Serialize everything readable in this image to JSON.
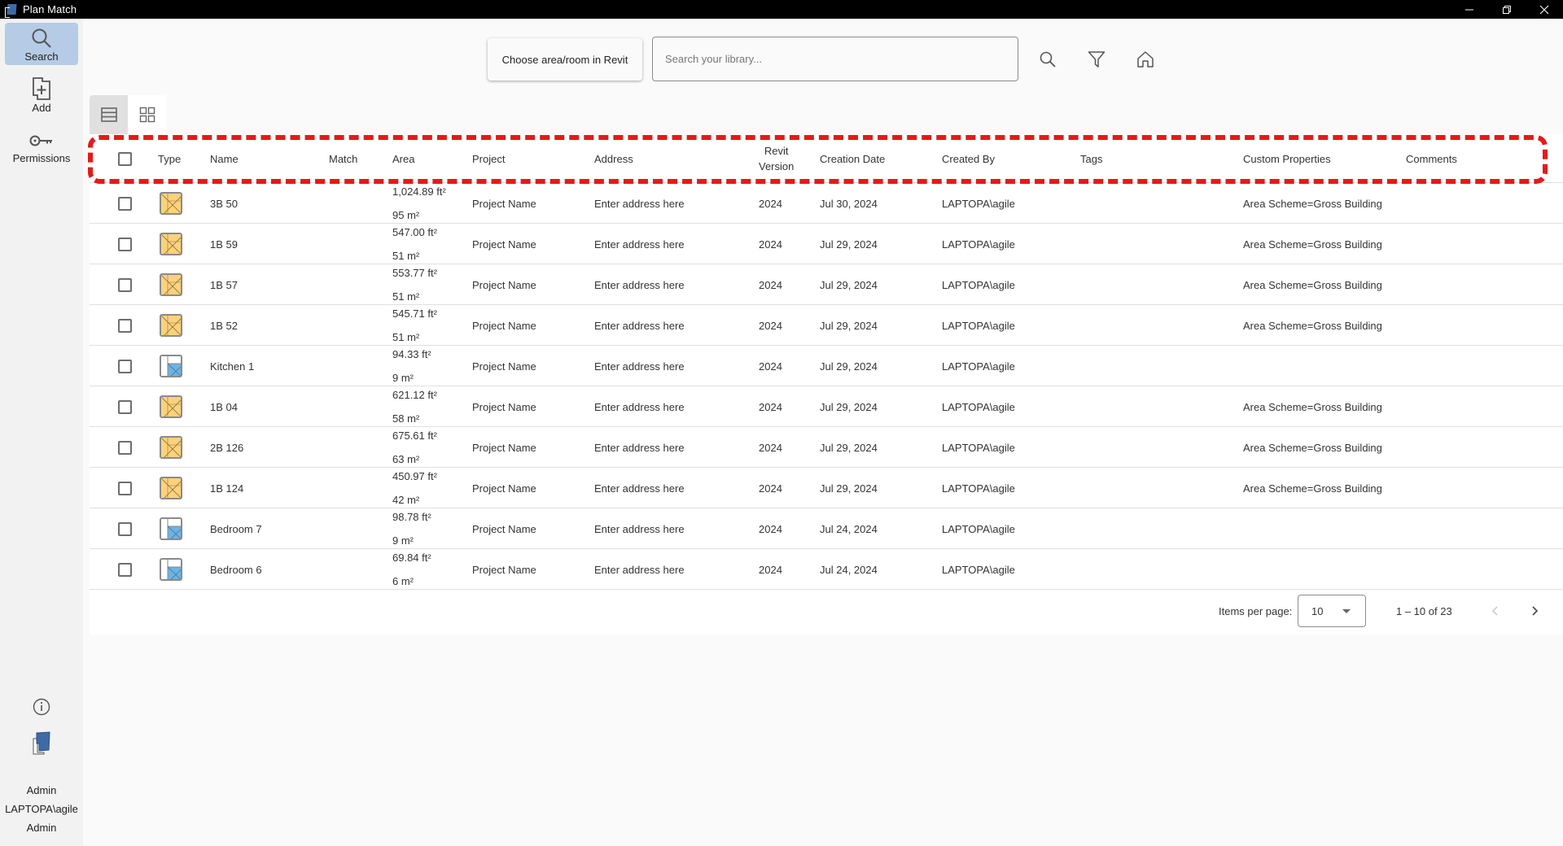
{
  "window": {
    "title": "Plan Match",
    "minimize_icon": "minimize-icon",
    "restore_icon": "restore-icon",
    "close_icon": "close-icon"
  },
  "sidebar": {
    "items": [
      {
        "label": "Search",
        "icon": "search-icon",
        "active": true
      },
      {
        "label": "Add",
        "icon": "add-document-icon",
        "active": false
      },
      {
        "label": "Permissions",
        "icon": "key-icon",
        "active": false
      }
    ],
    "info_icon": "info-icon",
    "logo_icon": "plan-match-logo-icon",
    "user": {
      "role": "Admin",
      "account": "LAPTOPA\\agile",
      "group": "Admin"
    }
  },
  "toolbar": {
    "choose_button_label": "Choose area/room in Revit",
    "search_placeholder": "Search your library...",
    "search_value": "",
    "search_icon": "search-icon",
    "filter_icon": "filter-icon",
    "home_icon": "home-icon"
  },
  "view_toggle": {
    "list_icon": "list-view-icon",
    "grid_icon": "grid-view-icon",
    "active": "list"
  },
  "table": {
    "columns": {
      "type": "Type",
      "name": "Name",
      "match": "Match",
      "area": "Area",
      "project": "Project",
      "address": "Address",
      "revit_version_line1": "Revit",
      "revit_version_line2": "Version",
      "creation_date": "Creation Date",
      "created_by": "Created By",
      "tags": "Tags",
      "custom_properties": "Custom Properties",
      "comments": "Comments"
    },
    "rows": [
      {
        "type": "area",
        "name": "3B 50",
        "match": "",
        "area_ft": "1,024.89 ft²",
        "area_m": "95 m²",
        "project": "Project Name",
        "address": "Enter address here",
        "revit_version": "2024",
        "creation_date": "Jul 30, 2024",
        "created_by": "LAPTOPA\\agile",
        "tags": "",
        "custom_properties": "Area Scheme=Gross Building",
        "comments": ""
      },
      {
        "type": "area",
        "name": "1B 59",
        "match": "",
        "area_ft": "547.00 ft²",
        "area_m": "51 m²",
        "project": "Project Name",
        "address": "Enter address here",
        "revit_version": "2024",
        "creation_date": "Jul 29, 2024",
        "created_by": "LAPTOPA\\agile",
        "tags": "",
        "custom_properties": "Area Scheme=Gross Building",
        "comments": ""
      },
      {
        "type": "area",
        "name": "1B 57",
        "match": "",
        "area_ft": "553.77 ft²",
        "area_m": "51 m²",
        "project": "Project Name",
        "address": "Enter address here",
        "revit_version": "2024",
        "creation_date": "Jul 29, 2024",
        "created_by": "LAPTOPA\\agile",
        "tags": "",
        "custom_properties": "Area Scheme=Gross Building",
        "comments": ""
      },
      {
        "type": "area",
        "name": "1B 52",
        "match": "",
        "area_ft": "545.71 ft²",
        "area_m": "51 m²",
        "project": "Project Name",
        "address": "Enter address here",
        "revit_version": "2024",
        "creation_date": "Jul 29, 2024",
        "created_by": "LAPTOPA\\agile",
        "tags": "",
        "custom_properties": "Area Scheme=Gross Building",
        "comments": ""
      },
      {
        "type": "room",
        "name": "Kitchen 1",
        "match": "",
        "area_ft": "94.33 ft²",
        "area_m": "9 m²",
        "project": "Project Name",
        "address": "Enter address here",
        "revit_version": "2024",
        "creation_date": "Jul 29, 2024",
        "created_by": "LAPTOPA\\agile",
        "tags": "",
        "custom_properties": "",
        "comments": ""
      },
      {
        "type": "area",
        "name": "1B 04",
        "match": "",
        "area_ft": "621.12 ft²",
        "area_m": "58 m²",
        "project": "Project Name",
        "address": "Enter address here",
        "revit_version": "2024",
        "creation_date": "Jul 29, 2024",
        "created_by": "LAPTOPA\\agile",
        "tags": "",
        "custom_properties": "Area Scheme=Gross Building",
        "comments": ""
      },
      {
        "type": "area",
        "name": "2B 126",
        "match": "",
        "area_ft": "675.61 ft²",
        "area_m": "63 m²",
        "project": "Project Name",
        "address": "Enter address here",
        "revit_version": "2024",
        "creation_date": "Jul 29, 2024",
        "created_by": "LAPTOPA\\agile",
        "tags": "",
        "custom_properties": "Area Scheme=Gross Building",
        "comments": ""
      },
      {
        "type": "area",
        "name": "1B 124",
        "match": "",
        "area_ft": "450.97 ft²",
        "area_m": "42 m²",
        "project": "Project Name",
        "address": "Enter address here",
        "revit_version": "2024",
        "creation_date": "Jul 29, 2024",
        "created_by": "LAPTOPA\\agile",
        "tags": "",
        "custom_properties": "Area Scheme=Gross Building",
        "comments": ""
      },
      {
        "type": "room",
        "name": "Bedroom 7",
        "match": "",
        "area_ft": "98.78 ft²",
        "area_m": "9 m²",
        "project": "Project Name",
        "address": "Enter address here",
        "revit_version": "2024",
        "creation_date": "Jul 24, 2024",
        "created_by": "LAPTOPA\\agile",
        "tags": "",
        "custom_properties": "",
        "comments": ""
      },
      {
        "type": "room",
        "name": "Bedroom 6",
        "match": "",
        "area_ft": "69.84 ft²",
        "area_m": "6 m²",
        "project": "Project Name",
        "address": "Enter address here",
        "revit_version": "2024",
        "creation_date": "Jul 24, 2024",
        "created_by": "LAPTOPA\\agile",
        "tags": "",
        "custom_properties": "",
        "comments": ""
      }
    ]
  },
  "pagination": {
    "items_per_page_label": "Items per page:",
    "items_per_page": "10",
    "range_label": "1 – 10 of 23",
    "prev_enabled": false,
    "next_enabled": true
  },
  "colors": {
    "accent_active_nav": "#b6cbe5",
    "highlight_dash": "#e61919",
    "area_icon_fill": "#ffd27a",
    "room_icon_fill": "#6fb3e3"
  }
}
